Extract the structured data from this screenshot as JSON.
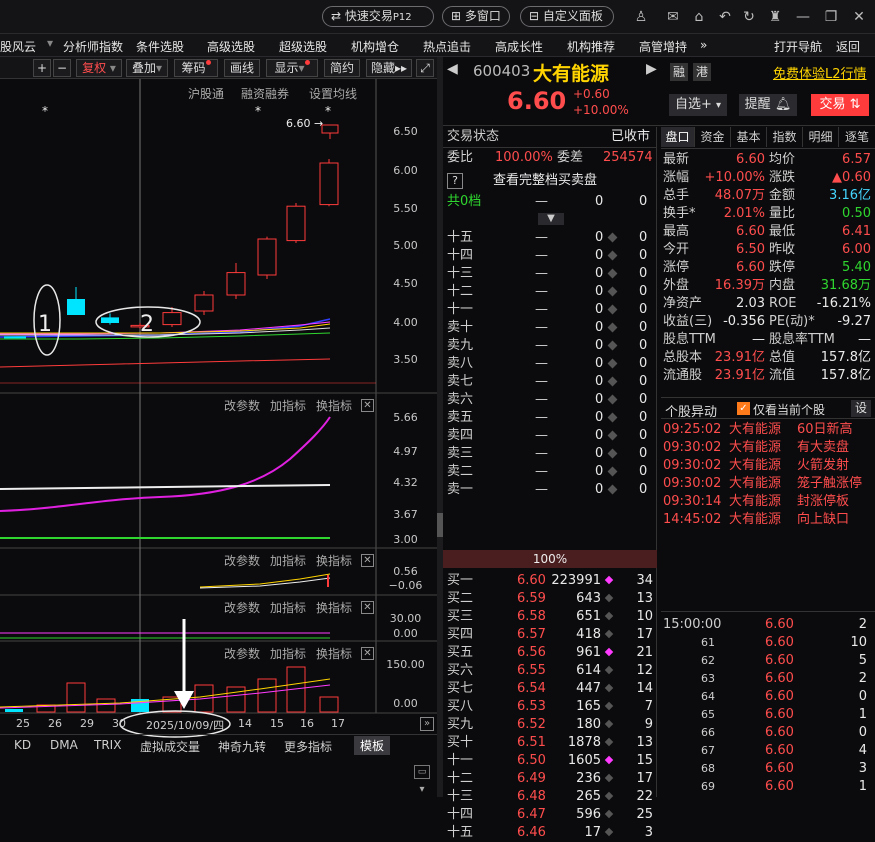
{
  "topbar": {
    "quick_trade": "快速交易",
    "quick_trade_key": "P12",
    "multi_window": "多窗口",
    "custom_panel": "自定义面板",
    "icons": [
      "user-icon",
      "mail-icon",
      "home-icon",
      "undo-icon",
      "refresh-icon",
      "shirt-icon",
      "minimize-icon",
      "restore-icon",
      "close-icon"
    ]
  },
  "menu": {
    "items": [
      "股风云",
      "分析师指数",
      "条件选股",
      "高级选股",
      "超级选股",
      "机构增仓",
      "热点追击",
      "高成长性",
      "机构推荐",
      "高管增持"
    ],
    "more": "»",
    "open_nav": "打开导航",
    "back": "返回"
  },
  "toolbar": {
    "plus": "+",
    "minus": "−",
    "fuquan": "复权",
    "diejia": "叠加",
    "chouma": "筹码",
    "huaxian": "画线",
    "xianshi": "显示",
    "jianyue": "简约",
    "yincang": "隐藏"
  },
  "kline": {
    "links": [
      "沪股通",
      "融资融券",
      "设置均线"
    ],
    "price_label": "6.60",
    "y_ticks": [
      "6.50",
      "6.00",
      "5.50",
      "5.00",
      "4.50",
      "4.00",
      "3.50"
    ],
    "annot_1": "1",
    "annot_2": "2",
    "colors": {
      "up": "#ff3b3b",
      "down": "#00e5ff"
    }
  },
  "ind1": {
    "tools": [
      "改参数",
      "加指标",
      "换指标"
    ],
    "y_ticks": [
      "5.66",
      "4.97",
      "4.32",
      "3.67",
      "3.00"
    ]
  },
  "ind2": {
    "tools": [
      "改参数",
      "加指标",
      "换指标"
    ],
    "y_ticks": [
      "0.56",
      "−0.06"
    ]
  },
  "ind3": {
    "tools": [
      "改参数",
      "加指标",
      "换指标"
    ],
    "y_ticks": [
      "30.00",
      "0.00"
    ]
  },
  "ind4": {
    "tools": [
      "改参数",
      "加指标",
      "换指标"
    ],
    "y_ticks": [
      "150.00",
      "0.00"
    ]
  },
  "xaxis": {
    "labels": [
      "25",
      "26",
      "29",
      "30",
      "2025/10/09/四",
      "14",
      "15",
      "16",
      "17"
    ],
    "more": "»"
  },
  "bottomtabs": {
    "items": [
      "KD",
      "DMA",
      "TRIX",
      "虚拟成交量",
      "神奇九转",
      "更多指标"
    ],
    "active": "模板"
  },
  "stock": {
    "code": "600403",
    "name": "大有能源",
    "price": "6.60",
    "change": "+0.60",
    "pct": "+10.00%",
    "rong": "融",
    "gang": "港",
    "l2": "免费体验L2行情",
    "zixuan": "自选",
    "tixing": "提醒",
    "jiaoyi": "交易"
  },
  "book": {
    "status_label": "交易状态",
    "status": "已收市",
    "weibi_label": "委比",
    "weibi": "100.00%",
    "weicha_label": "委差",
    "weicha": "254574",
    "full_label": "查看完整档买卖盘",
    "total_label": "共0档",
    "dash": "—",
    "zero": "0",
    "sells": [
      "十五",
      "十四",
      "十三",
      "十二",
      "十一",
      "卖十",
      "卖九",
      "卖八",
      "卖七",
      "卖六",
      "卖五",
      "卖四",
      "卖三",
      "卖二",
      "卖一"
    ],
    "ratio": "100%",
    "buys": [
      [
        "买一",
        "6.60",
        "223991",
        "34"
      ],
      [
        "买二",
        "6.59",
        "643",
        "13"
      ],
      [
        "买三",
        "6.58",
        "651",
        "10"
      ],
      [
        "买四",
        "6.57",
        "418",
        "17"
      ],
      [
        "买五",
        "6.56",
        "961",
        "21"
      ],
      [
        "买六",
        "6.55",
        "614",
        "12"
      ],
      [
        "买七",
        "6.54",
        "447",
        "14"
      ],
      [
        "买八",
        "6.53",
        "165",
        "7"
      ],
      [
        "买九",
        "6.52",
        "180",
        "9"
      ],
      [
        "买十",
        "6.51",
        "1878",
        "13"
      ],
      [
        "十一",
        "6.50",
        "1605",
        "15"
      ],
      [
        "十二",
        "6.49",
        "236",
        "17"
      ],
      [
        "十三",
        "6.48",
        "265",
        "22"
      ],
      [
        "十四",
        "6.47",
        "596",
        "25"
      ],
      [
        "十五",
        "6.46",
        "17",
        "3"
      ]
    ]
  },
  "tabs": [
    "盘口",
    "资金",
    "基本",
    "指数",
    "明细",
    "逐笔"
  ],
  "quote": [
    [
      "最新",
      "6.60",
      "均价",
      "6.57"
    ],
    [
      "涨幅",
      "+10.00%",
      "涨跌",
      "▲0.60"
    ],
    [
      "总手",
      "48.07万",
      "金额",
      "3.16亿"
    ],
    [
      "换手*",
      "2.01%",
      "量比",
      "0.50"
    ],
    [
      "最高",
      "6.60",
      "最低",
      "6.41"
    ],
    [
      "今开",
      "6.50",
      "昨收",
      "6.00"
    ],
    [
      "涨停",
      "6.60",
      "跌停",
      "5.40"
    ],
    [
      "外盘",
      "16.39万",
      "内盘",
      "31.68万"
    ],
    [
      "净资产",
      "2.03",
      "ROE",
      "-16.21%"
    ],
    [
      "收益(三)",
      "-0.356",
      "PE(动)*",
      "-9.27"
    ],
    [
      "股息TTM",
      "—",
      "股息率TTM",
      "—"
    ],
    [
      "总股本",
      "23.91亿",
      "总值",
      "157.8亿"
    ],
    [
      "流通股",
      "23.91亿",
      "流值",
      "157.8亿"
    ]
  ],
  "alerts": {
    "title": "个股异动",
    "checkbox": "仅看当前个股",
    "settings": "设",
    "items": [
      [
        "09:25:02",
        "大有能源",
        "60日新高"
      ],
      [
        "09:30:02",
        "大有能源",
        "有大卖盘"
      ],
      [
        "09:30:02",
        "大有能源",
        "火箭发射"
      ],
      [
        "09:30:02",
        "大有能源",
        "笼子触涨停"
      ],
      [
        "09:30:14",
        "大有能源",
        "封涨停板"
      ],
      [
        "14:45:02",
        "大有能源",
        "向上缺口"
      ]
    ]
  },
  "ticks": [
    [
      "15:00:00",
      "6.60",
      "2"
    ],
    [
      "61",
      "6.60",
      "10"
    ],
    [
      "62",
      "6.60",
      "5"
    ],
    [
      "63",
      "6.60",
      "2"
    ],
    [
      "64",
      "6.60",
      "0"
    ],
    [
      "65",
      "6.60",
      "1"
    ],
    [
      "66",
      "6.60",
      "0"
    ],
    [
      "67",
      "6.60",
      "4"
    ],
    [
      "68",
      "6.60",
      "3"
    ],
    [
      "69",
      "6.60",
      "1"
    ]
  ],
  "chart_data": {
    "type": "candlestick",
    "title": "",
    "candles": [
      {
        "open": 3.82,
        "close": 3.82,
        "high": 3.84,
        "low": 3.8
      },
      {
        "open": 4.3,
        "close": 4.1,
        "high": 4.45,
        "low": 4.1
      },
      {
        "open": 4.07,
        "close": 4.0,
        "high": 4.12,
        "low": 3.98
      },
      {
        "open": 3.97,
        "close": 3.97,
        "high": 4.0,
        "low": 3.93
      },
      {
        "open": 3.98,
        "close": 4.13,
        "high": 4.2,
        "low": 3.95
      },
      {
        "open": 4.15,
        "close": 4.35,
        "high": 4.4,
        "low": 4.1
      },
      {
        "open": 4.35,
        "close": 4.63,
        "high": 4.75,
        "low": 4.3
      },
      {
        "open": 4.6,
        "close": 5.05,
        "high": 5.08,
        "low": 4.55
      },
      {
        "open": 5.03,
        "close": 5.46,
        "high": 5.5,
        "low": 5.0
      },
      {
        "open": 5.48,
        "close": 6.0,
        "high": 6.05,
        "low": 5.46
      },
      {
        "open": 6.5,
        "close": 6.6,
        "high": 6.6,
        "low": 6.41
      }
    ],
    "ylim": [
      3.3,
      6.8
    ]
  }
}
